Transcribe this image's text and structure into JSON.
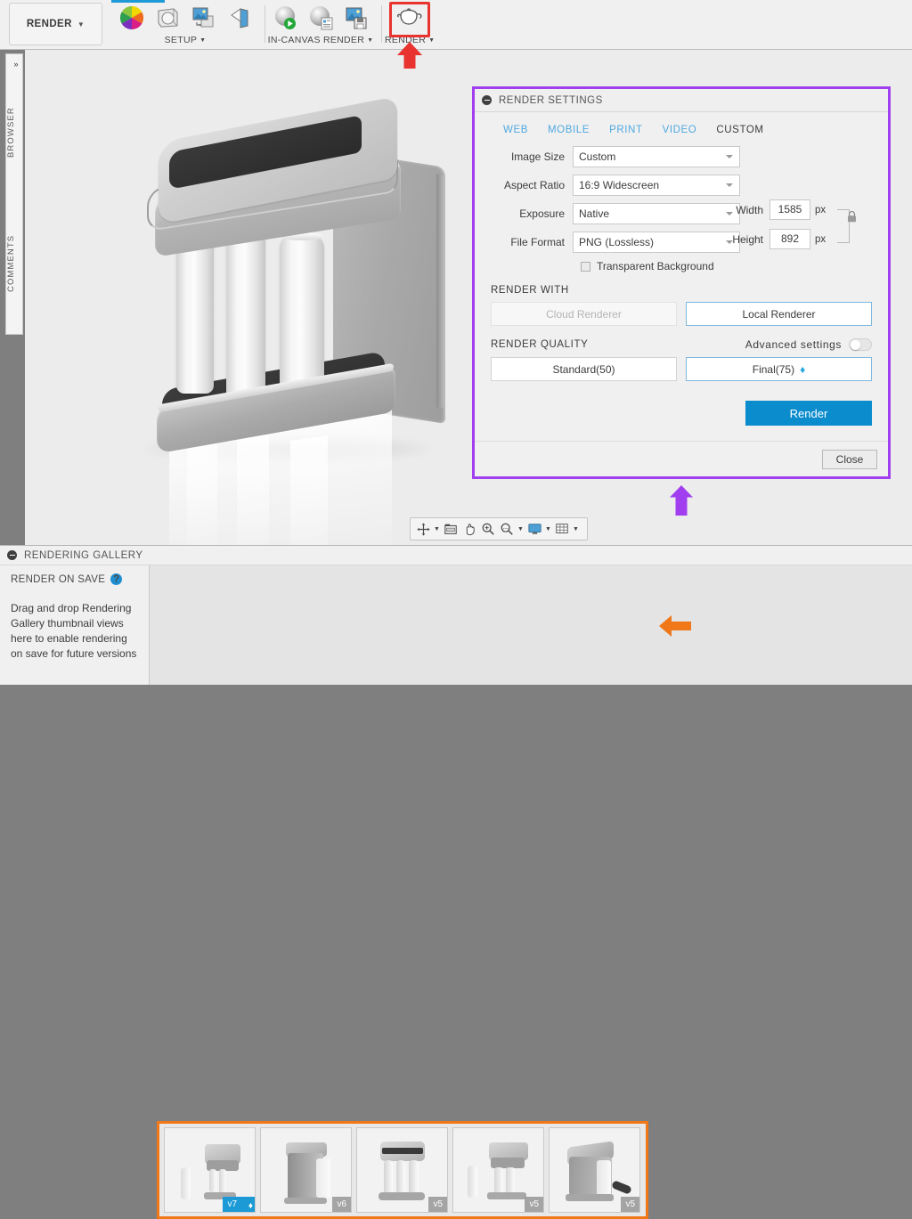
{
  "toolbar": {
    "workspace_label": "RENDER",
    "groups": [
      {
        "label": "SETUP",
        "icons": [
          "color-wheel-icon",
          "scene-settings-icon",
          "decal-icon",
          "texture-map-icon"
        ]
      },
      {
        "label": "IN-CANVAS RENDER",
        "icons": [
          "in-canvas-render-icon",
          "render-properties-icon",
          "capture-image-icon"
        ]
      },
      {
        "label": "RENDER",
        "icons": [
          "teapot-render-icon"
        ]
      }
    ]
  },
  "left_rail": {
    "expand_label": "»",
    "browser_label": "BROWSER",
    "comments_label": "COMMENTS"
  },
  "nav_toolbar": {
    "buttons": [
      "orbit-icon",
      "look-at-icon",
      "pan-icon",
      "zoom-icon",
      "zoom-window-icon",
      "display-settings-icon",
      "grid-settings-icon"
    ]
  },
  "dialog": {
    "title": "RENDER SETTINGS",
    "tabs": [
      {
        "label": "WEB",
        "active": false
      },
      {
        "label": "MOBILE",
        "active": false
      },
      {
        "label": "PRINT",
        "active": false
      },
      {
        "label": "VIDEO",
        "active": false
      },
      {
        "label": "CUSTOM",
        "active": true
      }
    ],
    "fields": [
      {
        "label": "Image Size",
        "value": "Custom"
      },
      {
        "label": "Aspect Ratio",
        "value": "16:9 Widescreen"
      },
      {
        "label": "Exposure",
        "value": "Native"
      },
      {
        "label": "File Format",
        "value": "PNG (Lossless)"
      }
    ],
    "dimensions": {
      "width_label": "Width",
      "width_value": "1585",
      "height_label": "Height",
      "height_value": "892",
      "unit": "px",
      "lock_icon": "lock-icon"
    },
    "transparent_background": {
      "label": "Transparent Background",
      "checked": false
    },
    "render_with": {
      "heading": "RENDER WITH",
      "cloud_label": "Cloud Renderer",
      "local_label": "Local Renderer",
      "selected": "Local Renderer"
    },
    "render_quality": {
      "heading": "RENDER QUALITY",
      "advanced_label": "Advanced settings",
      "advanced_on": false,
      "standard_label": "Standard(50)",
      "final_label": "Final(75)",
      "final_badge": "♦",
      "selected": "Final(75)"
    },
    "render_button": "Render",
    "close_button": "Close"
  },
  "gallery": {
    "title": "RENDERING GALLERY",
    "render_on_save_label": "RENDER ON SAVE",
    "help_icon": "help-icon",
    "help_glyph": "?",
    "dropzone_text": "Drag and drop Rendering Gallery thumbnail views here to enable rendering on save for future versions",
    "thumbnails": [
      {
        "version": "v7",
        "highlighted": true,
        "badge": "♦"
      },
      {
        "version": "v6",
        "highlighted": false,
        "badge": ""
      },
      {
        "version": "v5",
        "highlighted": false,
        "badge": ""
      },
      {
        "version": "v5",
        "highlighted": false,
        "badge": ""
      },
      {
        "version": "v5",
        "highlighted": false,
        "badge": ""
      }
    ]
  },
  "annotations": {
    "red_arrow": {
      "name": "render-button-arrow",
      "color": "#e8332f",
      "direction": "up"
    },
    "purple_arrow": {
      "name": "render-settings-arrow",
      "color": "#a13ef0",
      "direction": "up"
    },
    "orange_arrow": {
      "name": "gallery-arrow",
      "color": "#f07818",
      "direction": "left"
    }
  },
  "colors": {
    "highlight_red": "#e8332f",
    "highlight_purple": "#a13ef0",
    "highlight_orange": "#f07818",
    "accent_blue": "#0b8ccd",
    "tab_blue": "#4fa8e0"
  }
}
